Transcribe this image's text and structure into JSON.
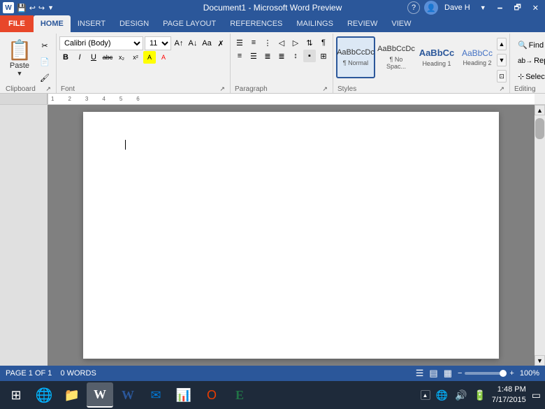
{
  "titlebar": {
    "title": "Document1 - Microsoft Word Preview",
    "quickaccess": [
      "💾",
      "↩",
      "↪"
    ],
    "user": "Dave H",
    "help": "?",
    "minimize": "🗕",
    "restore": "🗗",
    "close": "✕"
  },
  "ribbon": {
    "tabs": [
      "FILE",
      "HOME",
      "INSERT",
      "DESIGN",
      "PAGE LAYOUT",
      "REFERENCES",
      "MAILINGS",
      "REVIEW",
      "VIEW"
    ],
    "active_tab": "HOME",
    "groups": {
      "clipboard": {
        "label": "Clipboard",
        "paste_label": "Paste"
      },
      "font": {
        "label": "Font",
        "font_name": "Calibri (Body)",
        "font_size": "11",
        "grow": "A",
        "shrink": "A",
        "case": "Aa",
        "clear": "✗",
        "bold": "B",
        "italic": "I",
        "underline": "U",
        "strikethrough": "abc",
        "subscript": "x₂",
        "superscript": "x²",
        "highlight": "A",
        "color": "A"
      },
      "paragraph": {
        "label": "Paragraph"
      },
      "styles": {
        "label": "Styles",
        "items": [
          {
            "preview": "AaBbCcDc",
            "label": "¶ Normal",
            "active": true
          },
          {
            "preview": "AaBbCcDc",
            "label": "¶ No Spac..."
          },
          {
            "preview": "AaBbCc",
            "label": "Heading 1"
          },
          {
            "preview": "AaBbCc",
            "label": "Heading 2"
          }
        ]
      },
      "editing": {
        "label": "Editing",
        "find": "Find",
        "replace": "Replace",
        "select": "Select"
      }
    }
  },
  "document": {
    "content": ""
  },
  "statusbar": {
    "page": "PAGE 1 OF 1",
    "words": "0 WORDS",
    "zoom": "100%",
    "view_icons": [
      "☰",
      "▤",
      "▦"
    ]
  },
  "taskbar": {
    "start_icon": "⊞",
    "apps": [
      {
        "icon": "🌐",
        "name": "IE"
      },
      {
        "icon": "📁",
        "name": "Explorer"
      },
      {
        "icon": "W",
        "name": "Word",
        "active": true
      },
      {
        "icon": "W",
        "name": "Word2"
      },
      {
        "icon": "✉",
        "name": "Mail"
      },
      {
        "icon": "P",
        "name": "PowerPoint"
      },
      {
        "icon": "O",
        "name": "Office"
      },
      {
        "icon": "E",
        "name": "Excel"
      }
    ],
    "systray": [
      "🔊",
      "🌐",
      "🔋"
    ],
    "clock_time": "1:48 PM",
    "clock_date": "7/17/2015"
  }
}
